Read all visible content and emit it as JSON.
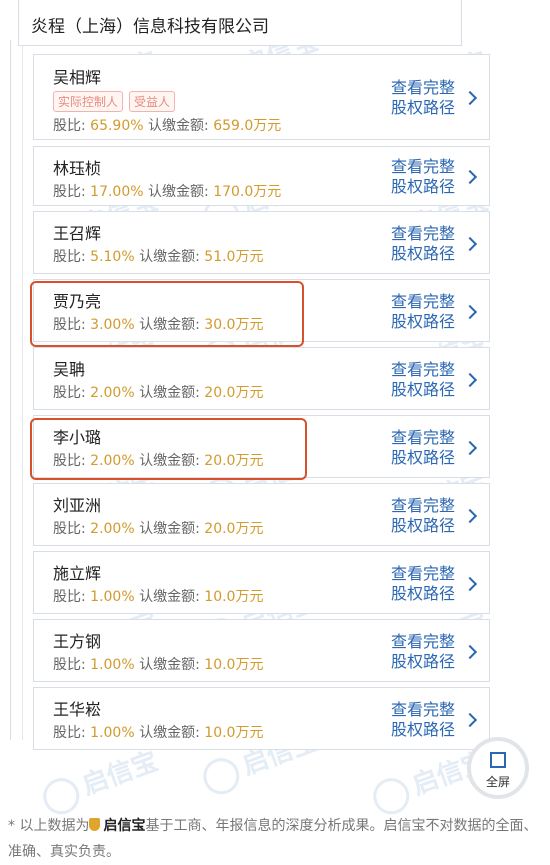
{
  "company": {
    "name": "炎程（上海）信息科技有限公司"
  },
  "labels": {
    "ratio": "股比: ",
    "amount": "认缴金额: ",
    "link_line1": "查看完整",
    "link_line2": "股权路径"
  },
  "shareholders": [
    {
      "name": "吴相辉",
      "tags": [
        "实际控制人",
        "受益人"
      ],
      "ratio": "65.90%",
      "amount": "659.0万元"
    },
    {
      "name": "林珏桢",
      "ratio": "17.00%",
      "amount": "170.0万元"
    },
    {
      "name": "王召辉",
      "ratio": "5.10%",
      "amount": "51.0万元"
    },
    {
      "name": "贾乃亮",
      "ratio": "3.00%",
      "amount": "30.0万元"
    },
    {
      "name": "吴聃",
      "ratio": "2.00%",
      "amount": "20.0万元"
    },
    {
      "name": "李小璐",
      "ratio": "2.00%",
      "amount": "20.0万元"
    },
    {
      "name": "刘亚洲",
      "ratio": "2.00%",
      "amount": "20.0万元"
    },
    {
      "name": "施立辉",
      "ratio": "1.00%",
      "amount": "10.0万元"
    },
    {
      "name": "王方钢",
      "ratio": "1.00%",
      "amount": "10.0万元"
    },
    {
      "name": "王华崧",
      "ratio": "1.00%",
      "amount": "10.0万元"
    }
  ],
  "fullscreen": {
    "label": "全屏"
  },
  "watermark": {
    "text": "启信宝"
  },
  "footer": {
    "prefix": "* 以上数据为",
    "brand": "启信宝",
    "suffix": "基于工商、年报信息的深度分析成果。启信宝不对数据的全面、准确、真实负责。"
  },
  "colors": {
    "link": "#2b67b3",
    "value": "#d39a2c",
    "highlight": "#d9502c",
    "tag": "#e88a7d"
  }
}
